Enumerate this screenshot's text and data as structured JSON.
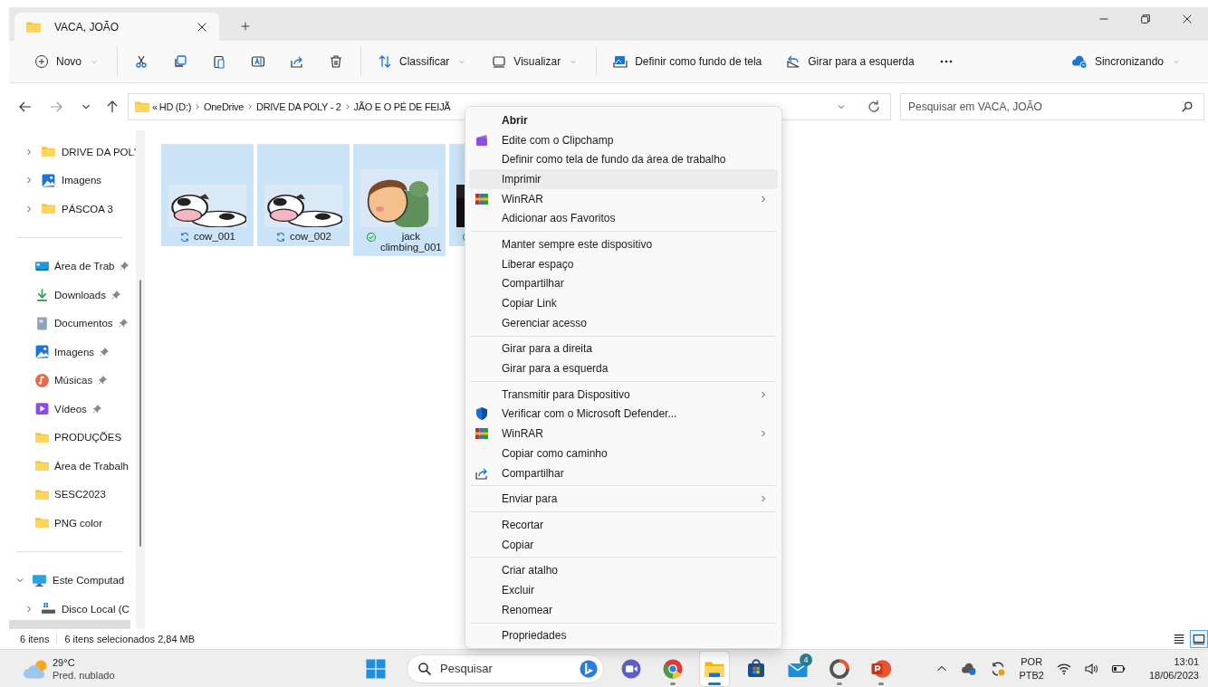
{
  "window": {
    "tab_title": "VACA, JOÃO"
  },
  "toolbar": {
    "groups": [
      [
        {
          "kind": "new",
          "label": "Novo",
          "dropdown": true
        }
      ],
      [
        {
          "kind": "cut"
        },
        {
          "kind": "copy"
        },
        {
          "kind": "paste"
        },
        {
          "kind": "rename"
        },
        {
          "kind": "share"
        },
        {
          "kind": "delete"
        }
      ],
      [
        {
          "kind": "sort",
          "label": "Classificar",
          "dropdown": true
        },
        {
          "kind": "view",
          "label": "Visualizar",
          "dropdown": true
        }
      ],
      [
        {
          "kind": "wallpaper",
          "label": "Definir como fundo de tela",
          "dropdown": false
        },
        {
          "kind": "rotate",
          "label": "Girar para a esquerda",
          "dropdown": false
        },
        {
          "kind": "more"
        }
      ]
    ],
    "sync": {
      "label": "Sincronizando"
    }
  },
  "address": {
    "overflow_glyph": "«",
    "crumbs": [
      "HD (D:)",
      "OneDrive",
      "DRIVE DA POLY - 2",
      "JÃO E O PÉ DE FEIJÃ"
    ]
  },
  "search": {
    "placeholder": "Pesquisar em VACA, JOÃO"
  },
  "sidebar": {
    "sections": [
      {
        "items": [
          {
            "label": "DRIVE DA POL'",
            "kind": "folder",
            "expanded": false
          },
          {
            "label": "Imagens",
            "kind": "pictures",
            "expanded": false
          },
          {
            "label": "PÁSCOA 3",
            "kind": "folder",
            "expanded": false
          }
        ]
      },
      {
        "items": [
          {
            "label": "Área de Trab",
            "kind": "desktop",
            "pinned": true
          },
          {
            "label": "Downloads",
            "kind": "download",
            "pinned": true
          },
          {
            "label": "Documentos",
            "kind": "documents",
            "pinned": true
          },
          {
            "label": "Imagens",
            "kind": "pictures",
            "pinned": true
          },
          {
            "label": "Músicas",
            "kind": "music",
            "pinned": true
          },
          {
            "label": "Vídeos",
            "kind": "videos",
            "pinned": true
          },
          {
            "label": "PRODUÇÕES",
            "kind": "folder",
            "pinned": false
          },
          {
            "label": "Área de Trabalh",
            "kind": "folder",
            "pinned": false
          },
          {
            "label": "SESC2023",
            "kind": "folder",
            "pinned": false
          },
          {
            "label": "PNG color",
            "kind": "folder",
            "pinned": false
          }
        ]
      },
      {
        "items": [
          {
            "label": "Este Computad",
            "kind": "pc",
            "expanded": true,
            "children": [
              {
                "label": "Disco Local (C",
                "kind": "drive",
                "expanded": false
              }
            ]
          }
        ]
      }
    ]
  },
  "files": [
    {
      "name": "cow_001",
      "synced": false,
      "selected": true
    },
    {
      "name": "cow_002",
      "synced": false,
      "selected": true
    },
    {
      "name": "jack climbing_001",
      "synced": true,
      "selected": true
    },
    {
      "synced": true,
      "selected": true
    }
  ],
  "status_bar": {
    "count": "6 itens",
    "selection": "6 itens selecionados  2,84 MB"
  },
  "view_buttons": [
    {
      "kind": "details",
      "selected": false
    },
    {
      "kind": "tiles",
      "selected": true
    }
  ],
  "context_menu": {
    "groups": [
      [
        {
          "label": "Abrir",
          "default": true,
          "hovered": false
        },
        {
          "label": "Edite com o Clipchamp",
          "kind": "clipchamp",
          "default": false,
          "hovered": false
        },
        {
          "label": "Definir como tela de fundo da área de trabalho",
          "default": false,
          "hovered": false
        },
        {
          "label": "Imprimir",
          "default": false,
          "hovered": true
        },
        {
          "label": "WinRAR",
          "kind": "winrar",
          "submenu": true,
          "default": false,
          "hovered": false
        },
        {
          "label": "Adicionar aos Favoritos",
          "default": false,
          "hovered": false
        }
      ],
      [
        {
          "label": "Manter sempre este dispositivo",
          "default": false,
          "hovered": false
        },
        {
          "label": "Liberar espaço",
          "default": false,
          "hovered": false
        },
        {
          "label": "Compartilhar",
          "default": false,
          "hovered": false
        },
        {
          "label": "Copiar Link",
          "default": false,
          "hovered": false
        },
        {
          "label": "Gerenciar acesso",
          "default": false,
          "hovered": false
        }
      ],
      [
        {
          "label": "Girar para a direita",
          "default": false,
          "hovered": false
        },
        {
          "label": "Girar para a esquerda",
          "default": false,
          "hovered": false
        }
      ],
      [
        {
          "label": "Transmitir para Dispositivo",
          "submenu": true,
          "default": false,
          "hovered": false
        },
        {
          "label": "Verificar com o Microsoft Defender...",
          "kind": "shield",
          "default": false,
          "hovered": false
        },
        {
          "label": "WinRAR",
          "kind": "winrar",
          "submenu": true,
          "default": false,
          "hovered": false
        },
        {
          "label": "Copiar como caminho",
          "default": false,
          "hovered": false
        },
        {
          "label": "Compartilhar",
          "kind": "share",
          "default": false,
          "hovered": false
        }
      ],
      [
        {
          "label": "Enviar para",
          "submenu": true,
          "default": false,
          "hovered": false
        }
      ],
      [
        {
          "label": "Recortar",
          "default": false,
          "hovered": false
        },
        {
          "label": "Copiar",
          "default": false,
          "hovered": false
        }
      ],
      [
        {
          "label": "Criar atalho",
          "default": false,
          "hovered": false
        },
        {
          "label": "Excluir",
          "default": false,
          "hovered": false
        },
        {
          "label": "Renomear",
          "default": false,
          "hovered": false
        }
      ],
      [
        {
          "label": "Propriedades",
          "default": false,
          "hovered": false
        }
      ]
    ]
  },
  "taskbar": {
    "weather": {
      "temp": "29°C",
      "condition": "Pred. nublado"
    },
    "search": {
      "placeholder": "Pesquisar"
    },
    "apps": [
      {
        "kind": "meet",
        "running": false,
        "active": false
      },
      {
        "kind": "chrome",
        "running": true,
        "active": false
      },
      {
        "kind": "explorer",
        "running": true,
        "active": true
      },
      {
        "kind": "store",
        "running": false,
        "active": false
      },
      {
        "kind": "mail",
        "running": false,
        "active": false,
        "badge": "4"
      },
      {
        "kind": "ring",
        "running": true,
        "active": false
      },
      {
        "kind": "powerpoint",
        "running": true,
        "active": false
      }
    ],
    "language": {
      "code": "POR",
      "layout": "PTB2"
    },
    "clock": {
      "time": "13:01",
      "date": "18/06/2023"
    }
  }
}
